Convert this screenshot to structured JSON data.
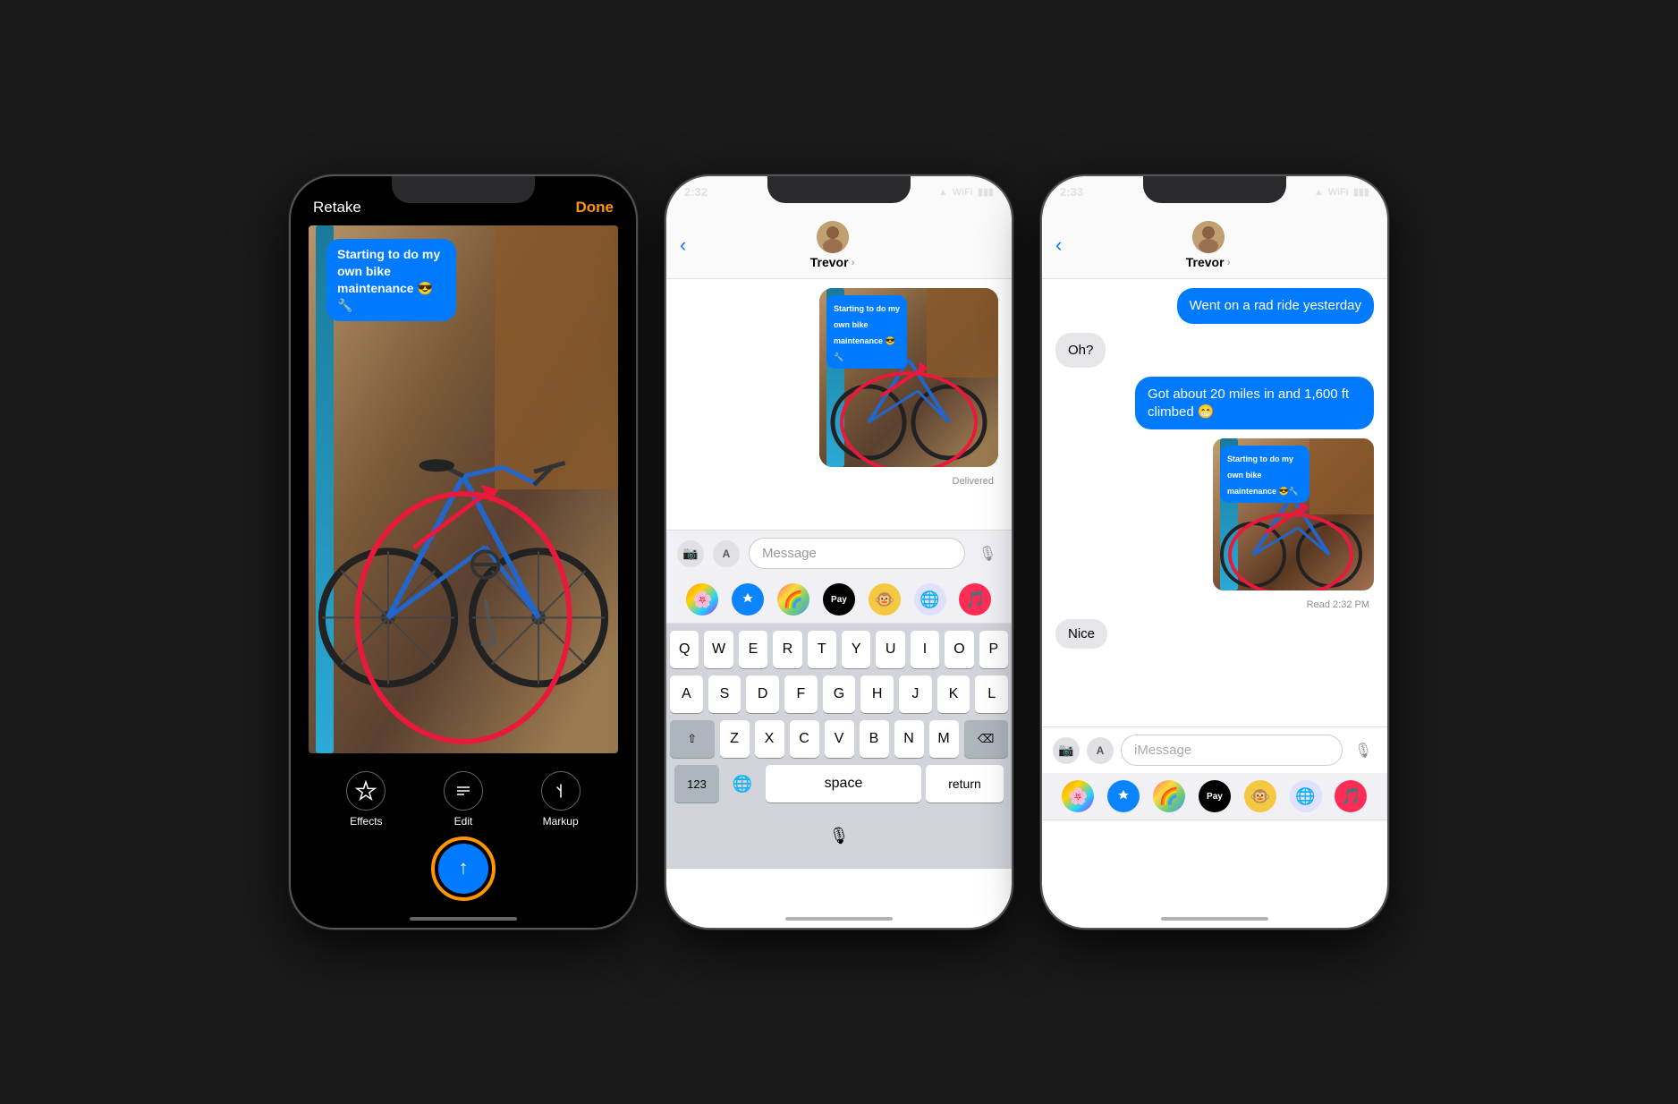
{
  "phone1": {
    "header": {
      "retake": "Retake",
      "done": "Done"
    },
    "photo_bubble": {
      "text": "Starting to do my own bike maintenance 😎🔧"
    },
    "toolbar": {
      "effects_label": "Effects",
      "edit_label": "Edit",
      "markup_label": "Markup"
    }
  },
  "phone2": {
    "status_bar": {
      "time": "2:32",
      "signal": "▲",
      "wifi": "wifi",
      "battery": "battery"
    },
    "contact_name": "Trevor",
    "contact_chevron": "›",
    "messages": [
      {
        "type": "photo",
        "has_bubble": true,
        "bubble_text": "Starting to do my own bike maintenance 😎🔧"
      },
      {
        "type": "status",
        "text": "Delivered"
      }
    ],
    "input": {
      "placeholder": "Message"
    },
    "keyboard": {
      "row1": [
        "Q",
        "W",
        "E",
        "R",
        "T",
        "Y",
        "U",
        "I",
        "O",
        "P"
      ],
      "row2": [
        "A",
        "S",
        "D",
        "F",
        "G",
        "H",
        "J",
        "K",
        "L"
      ],
      "row3": [
        "Z",
        "X",
        "C",
        "V",
        "B",
        "N",
        "M"
      ],
      "special": {
        "shift": "⇧",
        "backspace": "⌫",
        "numbers": "123",
        "space": "space",
        "return": "return"
      }
    }
  },
  "phone3": {
    "status_bar": {
      "time": "2:33"
    },
    "contact_name": "Trevor",
    "contact_chevron": "›",
    "messages": [
      {
        "type": "sent",
        "text": "Went on a rad ride yesterday"
      },
      {
        "type": "received",
        "text": "Oh?"
      },
      {
        "type": "sent",
        "text": "Got about 20 miles in and 1,600 ft climbed 😁"
      },
      {
        "type": "photo",
        "bubble_text": "Starting to do my own bike maintenance 😎🔧"
      },
      {
        "type": "status",
        "text": "Read 2:32 PM"
      },
      {
        "type": "received",
        "text": "Nice"
      }
    ],
    "input": {
      "placeholder": "iMessage"
    }
  }
}
